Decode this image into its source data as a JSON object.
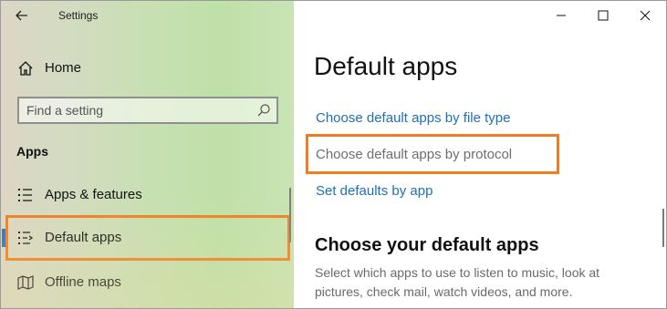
{
  "window": {
    "title": "Settings"
  },
  "sidebar": {
    "home_label": "Home",
    "search": {
      "placeholder": "Find a setting"
    },
    "section_title": "Apps",
    "items": [
      {
        "label": "Apps & features",
        "icon": "apps-features-icon"
      },
      {
        "label": "Default apps",
        "icon": "default-apps-icon",
        "selected": true
      },
      {
        "label": "Offline maps",
        "icon": "offline-maps-icon"
      }
    ]
  },
  "main": {
    "title": "Default apps",
    "links": [
      {
        "label": "Choose default apps by file type"
      },
      {
        "label": "Choose default apps by protocol"
      },
      {
        "label": "Set defaults by app"
      }
    ],
    "section_heading": "Choose your default apps",
    "description": "Select which apps to use to listen to music, look at pictures, check mail, watch videos, and more."
  },
  "colors": {
    "accent": "#1f6fb7",
    "highlight": "#f07d1f",
    "selection": "#2a6fbb"
  }
}
